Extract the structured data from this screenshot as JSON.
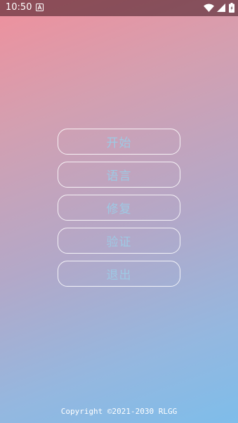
{
  "status_bar": {
    "time": "10:50",
    "icons": [
      "notification-a-icon",
      "wifi-icon",
      "signal-icon",
      "battery-icon"
    ]
  },
  "menu": {
    "items": [
      {
        "label": "开始"
      },
      {
        "label": "语言"
      },
      {
        "label": "修复"
      },
      {
        "label": "验证"
      },
      {
        "label": "退出"
      }
    ]
  },
  "footer": {
    "copyright": "Copyright ©2021-2030 RLGG"
  },
  "colors": {
    "gradient_top": "#f0909c",
    "gradient_bottom": "#7ebdea",
    "button_text": "#9ec9e4",
    "button_border": "#ffffff"
  }
}
